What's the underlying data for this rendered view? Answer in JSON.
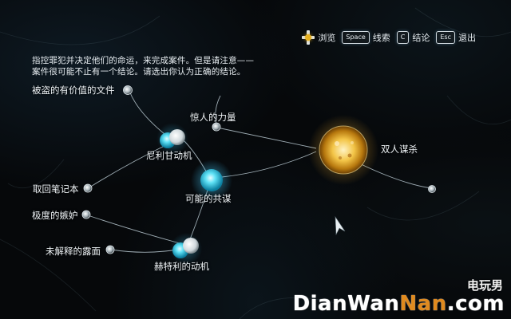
{
  "controls": {
    "browse_label": "浏览",
    "space_key": "Space",
    "search_label": "线索",
    "c_key": "C",
    "conclusion_label": "结论",
    "esc_key": "Esc",
    "exit_label": "退出"
  },
  "instructions": {
    "line1": "指控罪犯并决定他们的命运，来完成案件。但是请注意——",
    "line2": "案件很可能不止有一个结论。请选出你认为正确的结论。"
  },
  "nodes": {
    "stolen_document": "被盗的有价值的文件",
    "astonishing_power": "惊人的力量",
    "nelly_motive": "尼利甘动机",
    "double_murder": "双人谋杀",
    "retrieve_notebook": "取回笔记本",
    "possible_conspiracy": "可能的共谋",
    "extreme_jealousy": "极度的嫉妒",
    "unexplained_exposure": "未解释的露面",
    "hattery_motive": "赫特利的动机"
  },
  "watermark": {
    "small": "电玩男",
    "big_part1": "DianWan",
    "big_part2": "Nan",
    "big_part3": ".com"
  },
  "colors": {
    "accent_blue": "#3fd4f0",
    "accent_gold": "#f0b030",
    "line_color": "#b8c8d0"
  }
}
